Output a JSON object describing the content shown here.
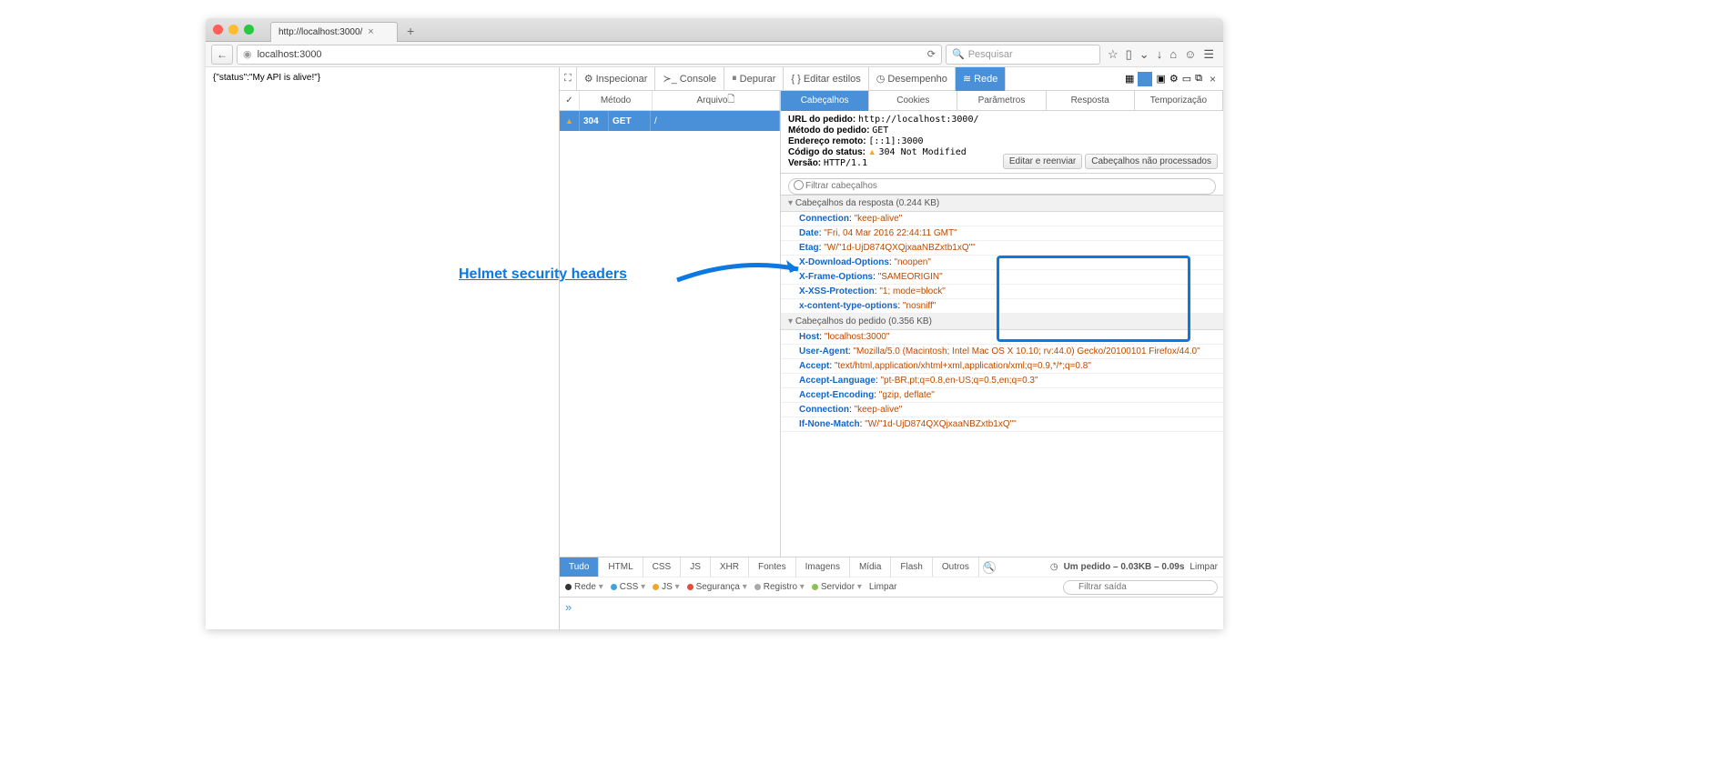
{
  "browser": {
    "tab_title": "http://localhost:3000/",
    "url": "localhost:3000",
    "search_placeholder": "Pesquisar"
  },
  "page_content": "{\"status\":\"My API is alive!\"}",
  "devtools": {
    "tabs": [
      "Inspecionar",
      "Console",
      "Depurar",
      "Editar estilos",
      "Desempenho",
      "Rede"
    ],
    "request_cols": {
      "method": "Método",
      "file": "Arquivo"
    },
    "request_row": {
      "status": "304",
      "method": "GET",
      "file": "/"
    },
    "detail_tabs": [
      "Cabeçalhos",
      "Cookies",
      "Parâmetros",
      "Resposta",
      "Temporização"
    ],
    "summary": {
      "url_lbl": "URL do pedido:",
      "url_val": "http://localhost:3000/",
      "method_lbl": "Método do pedido:",
      "method_val": "GET",
      "remote_lbl": "Endereço remoto:",
      "remote_val": "[::1]:3000",
      "status_lbl": "Código do status:",
      "status_val": "304 Not Modified",
      "version_lbl": "Versão:",
      "version_val": "HTTP/1.1",
      "btn_edit": "Editar e reenviar",
      "btn_raw": "Cabeçalhos não processados"
    },
    "filter_placeholder": "Filtrar cabeçalhos",
    "resphdr_title": "Cabeçalhos da resposta (0.244 KB)",
    "resp_headers": [
      {
        "k": "Connection",
        "v": "\"keep-alive\""
      },
      {
        "k": "Date",
        "v": "\"Fri, 04 Mar 2016 22:44:11 GMT\""
      },
      {
        "k": "Etag",
        "v": "\"W/\"1d-UjD874QXQjxaaNBZxtb1xQ\"\""
      },
      {
        "k": "X-Download-Options",
        "v": "\"noopen\""
      },
      {
        "k": "X-Frame-Options",
        "v": "\"SAMEORIGIN\""
      },
      {
        "k": "X-XSS-Protection",
        "v": "\"1; mode=block\""
      },
      {
        "k": "x-content-type-options",
        "v": "\"nosniff\""
      }
    ],
    "reqhdr_title": "Cabeçalhos do pedido (0.356 KB)",
    "req_headers": [
      {
        "k": "Host",
        "v": "\"localhost:3000\""
      },
      {
        "k": "User-Agent",
        "v": "\"Mozilla/5.0 (Macintosh; Intel Mac OS X 10.10; rv:44.0) Gecko/20100101 Firefox/44.0\""
      },
      {
        "k": "Accept",
        "v": "\"text/html,application/xhtml+xml,application/xml;q=0.9,*/*;q=0.8\""
      },
      {
        "k": "Accept-Language",
        "v": "\"pt-BR,pt;q=0.8,en-US;q=0.5,en;q=0.3\""
      },
      {
        "k": "Accept-Encoding",
        "v": "\"gzip, deflate\""
      },
      {
        "k": "Connection",
        "v": "\"keep-alive\""
      },
      {
        "k": "If-None-Match",
        "v": "\"W/\"1d-UjD874QXQjxaaNBZxtb1xQ\"\""
      }
    ],
    "filter_tabs": [
      "Tudo",
      "HTML",
      "CSS",
      "JS",
      "XHR",
      "Fontes",
      "Imagens",
      "Mídia",
      "Flash",
      "Outros"
    ],
    "footer_stat": "Um pedido – 0.03KB – 0.09s",
    "footer_clear": "Limpar",
    "footer2": {
      "rede": "Rede",
      "css": "CSS",
      "js": "JS",
      "seg": "Segurança",
      "reg": "Registro",
      "srv": "Servidor",
      "clear": "Limpar",
      "search": "Filtrar saída"
    }
  },
  "annotation": "Helmet security headers"
}
